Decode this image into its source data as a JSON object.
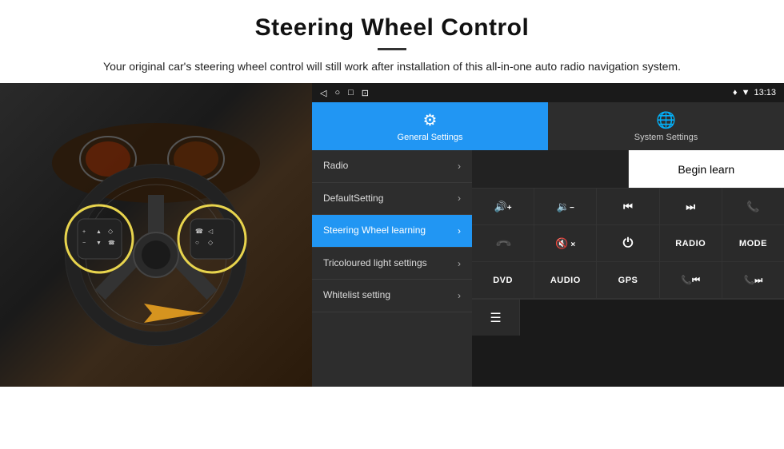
{
  "header": {
    "title": "Steering Wheel Control",
    "subtitle": "Your original car's steering wheel control will still work after installation of this all-in-one auto radio navigation system."
  },
  "statusBar": {
    "navIcons": [
      "◁",
      "○",
      "□",
      "⊡"
    ],
    "rightIcons": "♦ ▼",
    "time": "13:13"
  },
  "tabs": [
    {
      "id": "general",
      "label": "General Settings",
      "icon": "⚙",
      "active": true
    },
    {
      "id": "system",
      "label": "System Settings",
      "icon": "🌐",
      "active": false
    }
  ],
  "menuItems": [
    {
      "label": "Radio",
      "active": false
    },
    {
      "label": "DefaultSetting",
      "active": false
    },
    {
      "label": "Steering Wheel learning",
      "active": true
    },
    {
      "label": "Tricoloured light settings",
      "active": false
    },
    {
      "label": "Whitelist setting",
      "active": false
    }
  ],
  "controlPanel": {
    "beginLearn": "Begin learn",
    "row1": [
      "🔊+",
      "🔉−",
      "⏮",
      "⏭",
      "☎"
    ],
    "row2": [
      "↩",
      "🔇×",
      "⏻",
      "RADIO",
      "MODE"
    ],
    "row3": [
      "DVD",
      "AUDIO",
      "GPS",
      "☎⏮",
      "☎⏭"
    ],
    "bottomIcon": "☰"
  }
}
